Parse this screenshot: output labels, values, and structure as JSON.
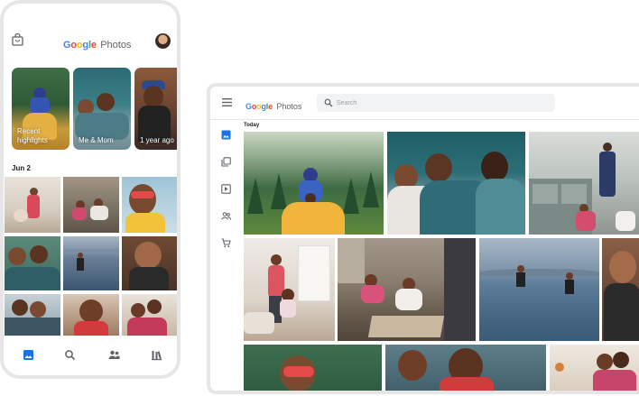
{
  "brand": {
    "google_letters": [
      "G",
      "o",
      "o",
      "g",
      "l",
      "e"
    ],
    "photos": "Photos"
  },
  "phone": {
    "memories": [
      {
        "label_line1": "Recent",
        "label_line2": "highlights"
      },
      {
        "label_line1": "Me & Mom",
        "label_line2": ""
      },
      {
        "label_line1": "1 year ago",
        "label_line2": ""
      }
    ],
    "date_label": "Jun 2",
    "nav": [
      "photos-icon",
      "search-icon",
      "sharing-icon",
      "library-icon"
    ],
    "accent": "#1a73e8"
  },
  "tablet": {
    "search": {
      "placeholder": "Search"
    },
    "section_label": "Today",
    "side_nav": [
      "photos-icon",
      "albums-icon",
      "utilities-icon",
      "sharing-icon",
      "print-store-icon"
    ]
  },
  "colors": {
    "accent_blue": "#1a73e8",
    "device_frame": "#e6e6e6"
  }
}
